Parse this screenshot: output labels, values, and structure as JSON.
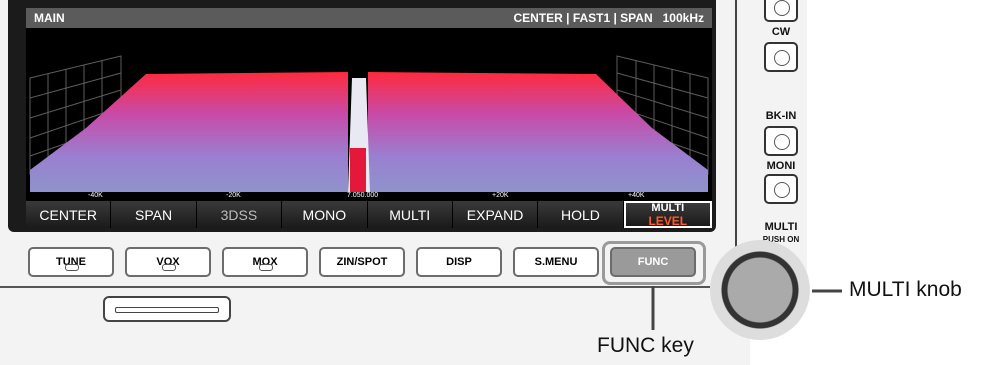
{
  "screen": {
    "header_main": "MAIN",
    "header_status": "CENTER | FAST1 | SPAN   100kHz",
    "freq_labels": [
      "-40K",
      "-20K",
      "7.050.000",
      "+20K",
      "+40K"
    ]
  },
  "softkeys": {
    "center": "CENTER",
    "span": "SPAN",
    "dss3": "3DSS",
    "mono": "MONO",
    "multi": "MULTI",
    "expand": "EXPAND",
    "hold": "HOLD",
    "multi_level_1": "MULTI",
    "multi_level_2": "LEVEL"
  },
  "keys": {
    "tune": "TUNE",
    "vox": "VOX",
    "mox": "MOX",
    "zin_spot": "ZIN/SPOT",
    "disp": "DISP",
    "smenu": "S.MENU",
    "func": "FUNC"
  },
  "side_labels": {
    "cw": "CW",
    "bkin": "BK-IN",
    "moni": "MONI",
    "multi": "MULTI",
    "push_on": "PUSH ON"
  },
  "callouts": {
    "multi_knob": "MULTI knob",
    "func_key": "FUNC key"
  },
  "colors": {
    "spectrum_top": "#ff2a3d",
    "spectrum_mid": "#a86bd6",
    "spectrum_low": "#8f93cc",
    "center_marker": "#e3183a"
  }
}
